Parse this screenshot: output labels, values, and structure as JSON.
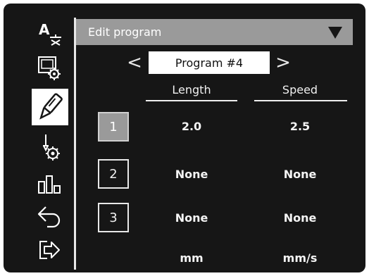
{
  "header": {
    "title": "Edit program"
  },
  "program_selector": {
    "prev_symbol": "<",
    "name": "Program #4",
    "next_symbol": ">"
  },
  "table": {
    "columns": [
      "Length",
      "Speed"
    ],
    "rows": [
      {
        "index": "1",
        "length": "2.0",
        "speed": "2.5",
        "selected": true
      },
      {
        "index": "2",
        "length": "None",
        "speed": "None",
        "selected": false
      },
      {
        "index": "3",
        "length": "None",
        "speed": "None",
        "selected": false
      }
    ],
    "units": [
      "mm",
      "mm/s"
    ]
  },
  "sidebar": {
    "items": [
      {
        "icon": "language-icon",
        "active": false
      },
      {
        "icon": "display-settings-icon",
        "active": false
      },
      {
        "icon": "pipette-icon",
        "active": true
      },
      {
        "icon": "dispenser-settings-icon",
        "active": false
      },
      {
        "icon": "statistics-icon",
        "active": false
      },
      {
        "icon": "back-icon",
        "active": false
      },
      {
        "icon": "exit-icon",
        "active": false
      }
    ]
  },
  "colors": {
    "background": "#161616",
    "header_bar": "#9a9a9a",
    "selected_button": "#9a9a9a",
    "foreground": "#ffffff"
  }
}
